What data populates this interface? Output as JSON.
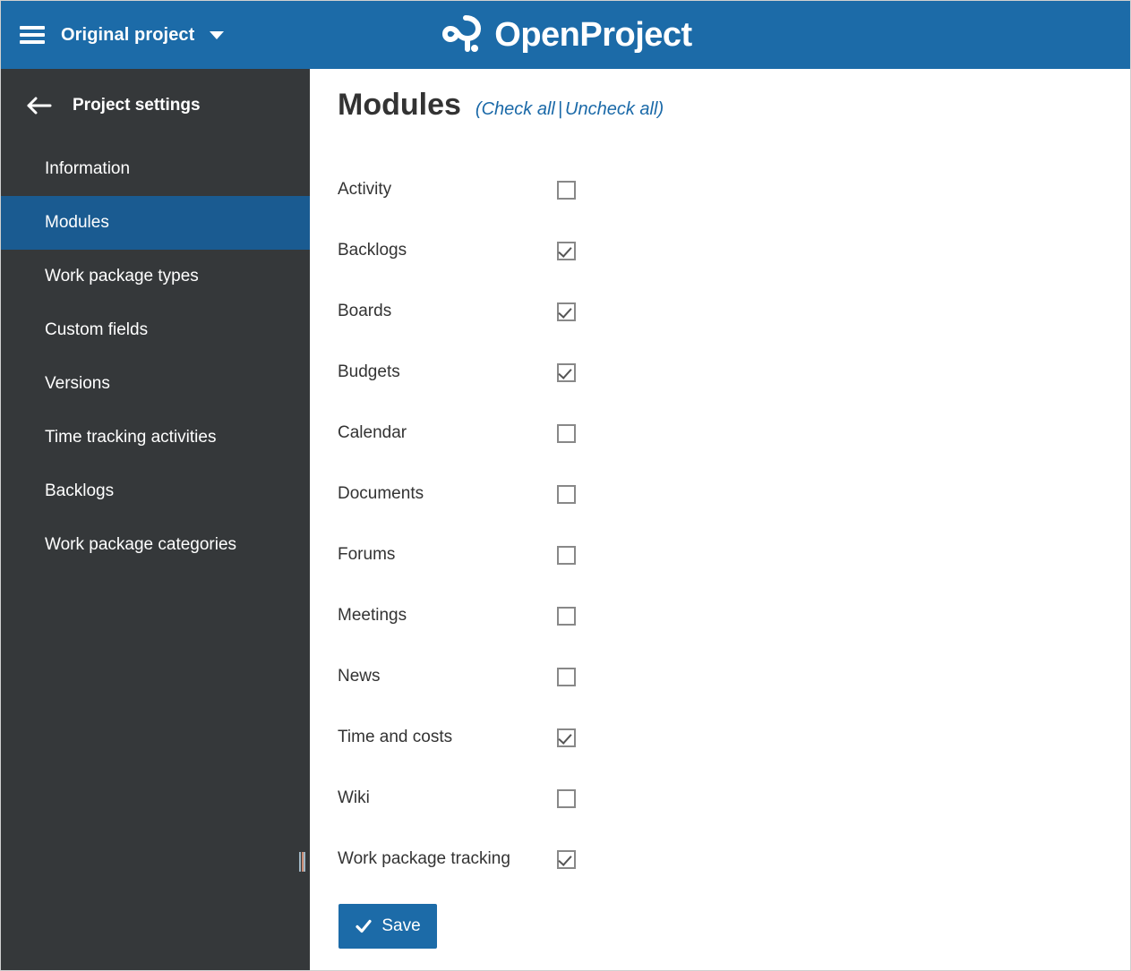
{
  "header": {
    "menu_icon": "hamburger-icon",
    "project_name": "Original project",
    "project_dropdown_icon": "chevron-down-icon",
    "brand_name": "OpenProject",
    "brand_logo_icon": "openproject-logo-icon",
    "background_color": "#1c6ba8"
  },
  "sidebar": {
    "back_icon": "arrow-left-icon",
    "title": "Project settings",
    "background_color": "#35383a",
    "selected_color": "#1a5b91",
    "selected_index": 1,
    "items": [
      {
        "label": "Information"
      },
      {
        "label": "Modules"
      },
      {
        "label": "Work package types"
      },
      {
        "label": "Custom fields"
      },
      {
        "label": "Versions"
      },
      {
        "label": "Time tracking activities"
      },
      {
        "label": "Backlogs"
      },
      {
        "label": "Work package categories"
      }
    ],
    "resize_handle_icon": "drag-handle-icon"
  },
  "main": {
    "title": "Modules",
    "paren_open": "(",
    "check_all_label": "Check all",
    "separator": "|",
    "uncheck_all_label": "Uncheck all",
    "paren_close": ")",
    "link_color": "#1a69a8",
    "modules": [
      {
        "label": "Activity",
        "checked": false
      },
      {
        "label": "Backlogs",
        "checked": true
      },
      {
        "label": "Boards",
        "checked": true
      },
      {
        "label": "Budgets",
        "checked": true
      },
      {
        "label": "Calendar",
        "checked": false
      },
      {
        "label": "Documents",
        "checked": false
      },
      {
        "label": "Forums",
        "checked": false
      },
      {
        "label": "Meetings",
        "checked": false
      },
      {
        "label": "News",
        "checked": false
      },
      {
        "label": "Time and costs",
        "checked": true
      },
      {
        "label": "Wiki",
        "checked": false
      },
      {
        "label": "Work package tracking",
        "checked": true
      }
    ],
    "save_label": "Save",
    "save_icon": "check-icon",
    "save_color": "#1c6ba8"
  }
}
